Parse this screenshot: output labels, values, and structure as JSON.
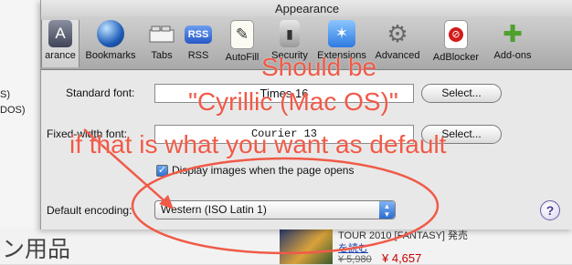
{
  "window": {
    "title": "Appearance"
  },
  "toolbar": {
    "items": [
      {
        "label": "arance",
        "icon": "appearance-icon"
      },
      {
        "label": "Bookmarks",
        "icon": "globe-icon"
      },
      {
        "label": "Tabs",
        "icon": "tabs-icon"
      },
      {
        "label": "RSS",
        "icon": "rss-icon",
        "badge": "RSS"
      },
      {
        "label": "AutoFill",
        "icon": "pencil-icon"
      },
      {
        "label": "Security",
        "icon": "lock-icon"
      },
      {
        "label": "Extensions",
        "icon": "extensions-icon"
      },
      {
        "label": "Advanced",
        "icon": "gear-icon"
      },
      {
        "label": "AdBlocker",
        "icon": "stop-icon"
      },
      {
        "label": "Add-ons",
        "icon": "puzzle-icon"
      }
    ]
  },
  "fonts": {
    "standard_label": "Standard font:",
    "standard_value": "Times 16",
    "fixed_label": "Fixed-width font:",
    "fixed_value": "Courier 13",
    "select_label": "Select..."
  },
  "display_images": {
    "label": "Display images when the page opens",
    "checked": true
  },
  "encoding": {
    "label": "Default encoding:",
    "value": "Western (ISO Latin 1)"
  },
  "help": {
    "label": "?"
  },
  "left_sheet": {
    "lines": [
      "S)",
      "DOS)"
    ]
  },
  "annotation": {
    "line1": "Should be",
    "line2": "\"Cyrillic (Mac OS)\"",
    "line3": "if that is what you want as default",
    "color": "#f05a48"
  },
  "background_page": {
    "jp_text": "ン用品",
    "item_text": "TOUR 2010 [FANTASY] 発売",
    "link_text": "を読む",
    "price_old": "¥ 5,980",
    "price_new": "¥ 4,657"
  }
}
